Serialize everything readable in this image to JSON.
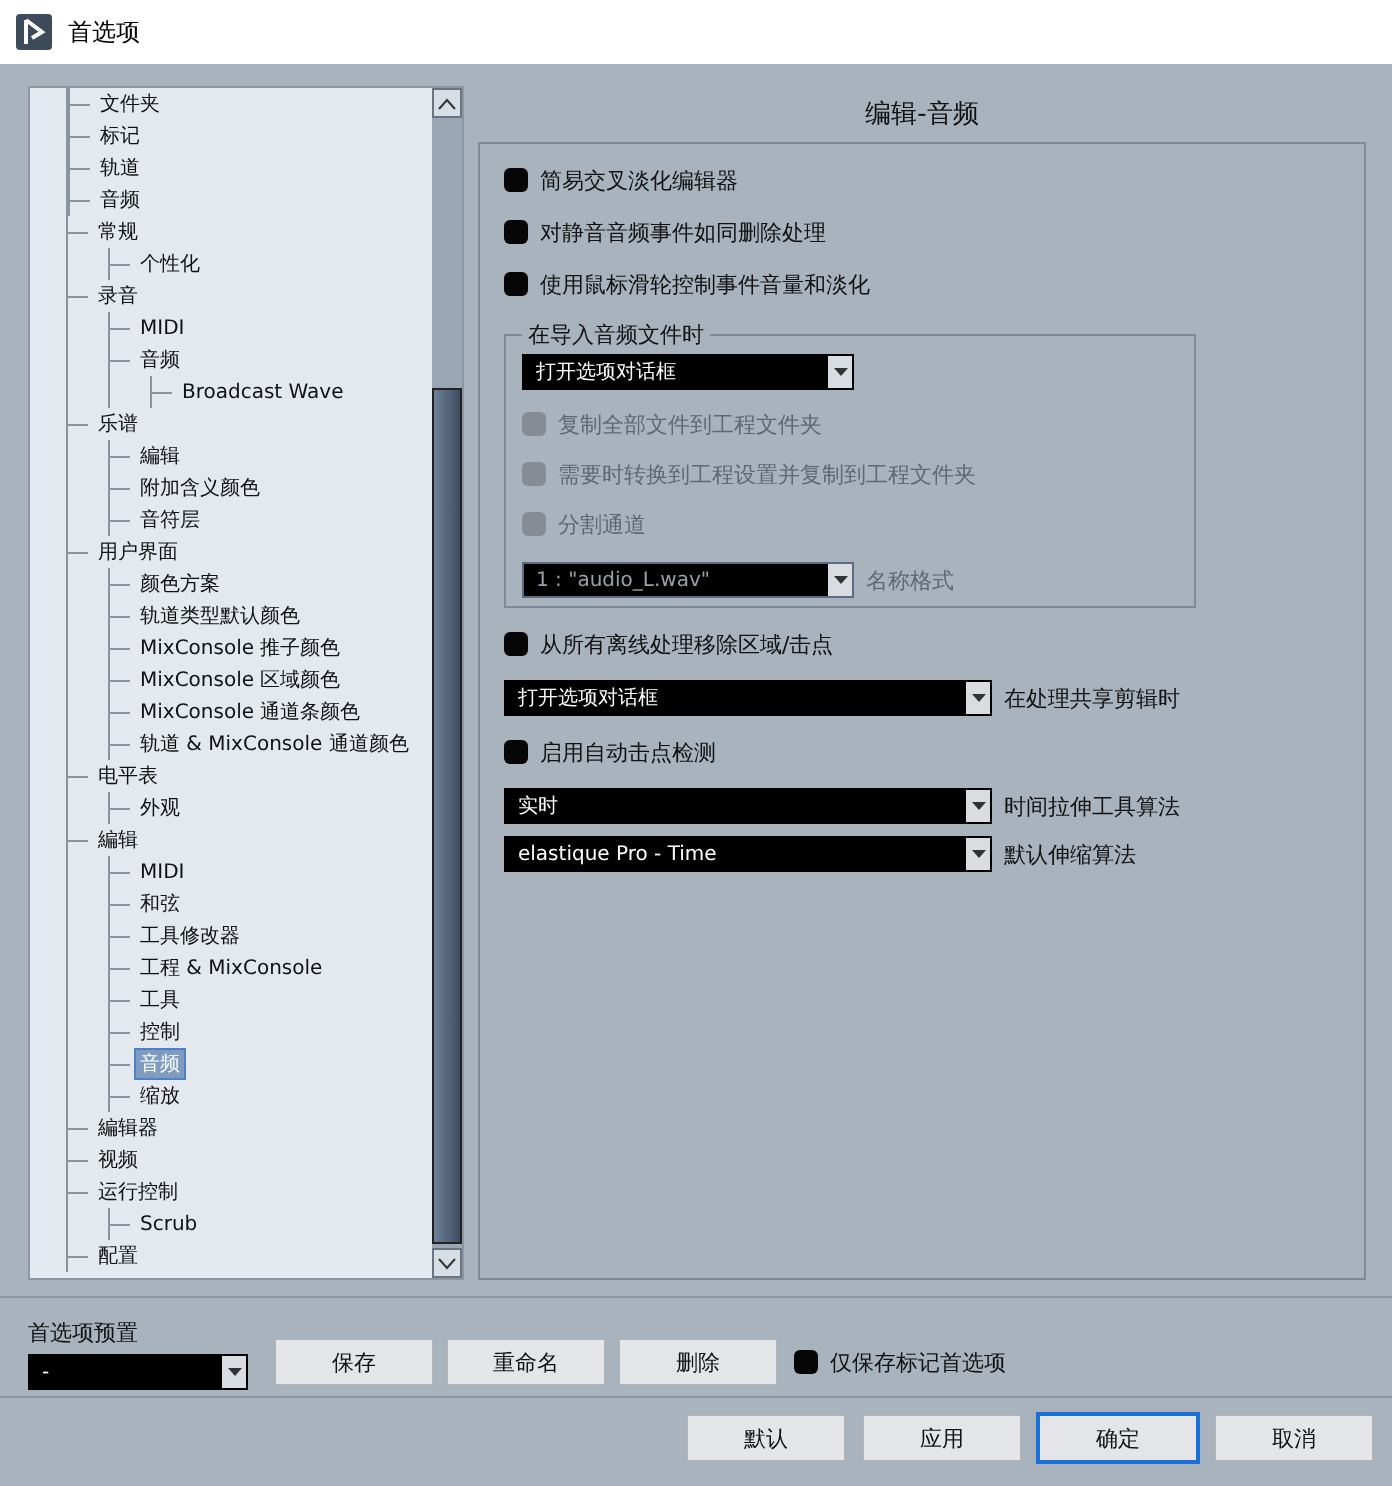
{
  "window": {
    "title": "首选项"
  },
  "tree": {
    "items": [
      {
        "children": [
          {
            "label": "文件夹",
            "selected": false
          },
          {
            "label": "标记",
            "selected": false
          },
          {
            "label": "轨道",
            "selected": false
          },
          {
            "label": "音频",
            "selected": false
          }
        ]
      },
      {
        "label": "常规",
        "selected": false,
        "children": [
          {
            "label": "个性化",
            "selected": false
          }
        ]
      },
      {
        "label": "录音",
        "selected": false,
        "children": [
          {
            "label": "MIDI",
            "selected": false
          },
          {
            "label": "音频",
            "selected": false,
            "children": [
              {
                "label": "Broadcast Wave",
                "selected": false
              }
            ]
          }
        ]
      },
      {
        "label": "乐谱",
        "selected": false,
        "children": [
          {
            "label": "編辑",
            "selected": false
          },
          {
            "label": "附加含义颜色",
            "selected": false
          },
          {
            "label": "音符层",
            "selected": false
          }
        ]
      },
      {
        "label": "用户界面",
        "selected": false,
        "children": [
          {
            "label": "颜色方案",
            "selected": false
          },
          {
            "label": "轨道类型默认颜色",
            "selected": false
          },
          {
            "label": "MixConsole 推子颜色",
            "selected": false
          },
          {
            "label": "MixConsole 区域颜色",
            "selected": false
          },
          {
            "label": "MixConsole 通道条颜色",
            "selected": false
          },
          {
            "label": "轨道 & MixConsole 通道颜色",
            "selected": false
          }
        ]
      },
      {
        "label": "电平表",
        "selected": false,
        "children": [
          {
            "label": "外观",
            "selected": false
          }
        ]
      },
      {
        "label": "編辑",
        "selected": false,
        "children": [
          {
            "label": "MIDI",
            "selected": false
          },
          {
            "label": "和弦",
            "selected": false
          },
          {
            "label": "工具修改器",
            "selected": false
          },
          {
            "label": "工程 & MixConsole",
            "selected": false
          },
          {
            "label": "工具",
            "selected": false
          },
          {
            "label": "控制",
            "selected": false
          },
          {
            "label": "音频",
            "selected": true
          },
          {
            "label": "缩放",
            "selected": false
          }
        ]
      },
      {
        "label": "編辑器",
        "selected": false
      },
      {
        "label": "视频",
        "selected": false
      },
      {
        "label": "运行控制",
        "selected": false,
        "children": [
          {
            "label": "Scrub",
            "selected": false
          }
        ]
      },
      {
        "label": "配置",
        "selected": false
      }
    ]
  },
  "page": {
    "title": "编辑-音频",
    "options_top": [
      {
        "label": "简易交叉淡化编辑器",
        "checked": false
      },
      {
        "label": "对静音音频事件如同删除处理",
        "checked": false
      },
      {
        "label": "使用鼠标滑轮控制事件音量和淡化",
        "checked": false
      }
    ],
    "import_group": {
      "title": "在导入音频文件时",
      "dropdown": {
        "value": "打开选项对话框"
      },
      "options": [
        {
          "label": "复制全部文件到工程文件夹",
          "checked": false,
          "disabled": true
        },
        {
          "label": "需要时转换到工程设置并复制到工程文件夹",
          "checked": false,
          "disabled": true
        },
        {
          "label": "分割通道",
          "checked": false,
          "disabled": true
        }
      ],
      "name_format": {
        "value": "1 : \"audio_L.wav\"",
        "label": "名称格式",
        "disabled": true
      }
    },
    "rows": [
      {
        "kind": "checkbox",
        "label": "从所有离线处理移除区域/击点",
        "checked": false
      },
      {
        "kind": "dropdown",
        "value": "打开选项对话框",
        "caption": "在处理共享剪辑时"
      },
      {
        "kind": "checkbox",
        "label": "启用自动击点检测",
        "checked": false
      },
      {
        "kind": "dropdown",
        "value": "实时",
        "caption": "时间拉伸工具算法"
      },
      {
        "kind": "dropdown",
        "value": "elastique Pro - Time",
        "caption": "默认伸缩算法"
      }
    ]
  },
  "presets": {
    "label": "首选项预置",
    "value": "-",
    "buttons": [
      "保存",
      "重命名",
      "删除"
    ],
    "only_marked": {
      "label": "仅保存标记首选项",
      "checked": false
    }
  },
  "buttons": [
    {
      "label": "默认",
      "focused": false
    },
    {
      "label": "应用",
      "focused": false
    },
    {
      "label": "确定",
      "focused": true
    },
    {
      "label": "取消",
      "focused": false
    }
  ]
}
